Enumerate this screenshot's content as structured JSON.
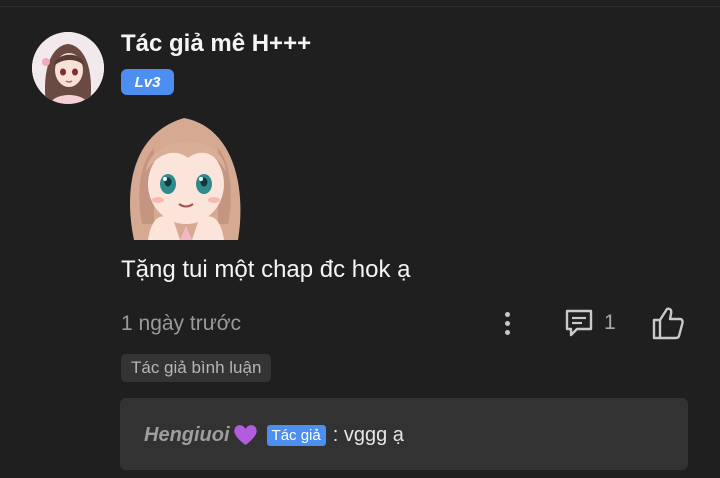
{
  "comment": {
    "username": "Tác giả mê H+++",
    "level": "Lv3",
    "text": "Tặng tui một chap đc hok ạ",
    "time": "1 ngày trước",
    "reply_count": "1",
    "tag": "Tác giả bình luận"
  },
  "reply": {
    "author": "Hengiuoi",
    "badge": "Tác giả",
    "text": ": vggg ạ"
  },
  "icons": {
    "more": "more-vertical-icon",
    "reply": "comment-icon",
    "like": "thumbs-up-icon",
    "heart": "purple-heart-icon"
  },
  "colors": {
    "background": "#1f1f1f",
    "badge_blue": "#4d8ff0",
    "heart_purple": "#b25ce0"
  }
}
